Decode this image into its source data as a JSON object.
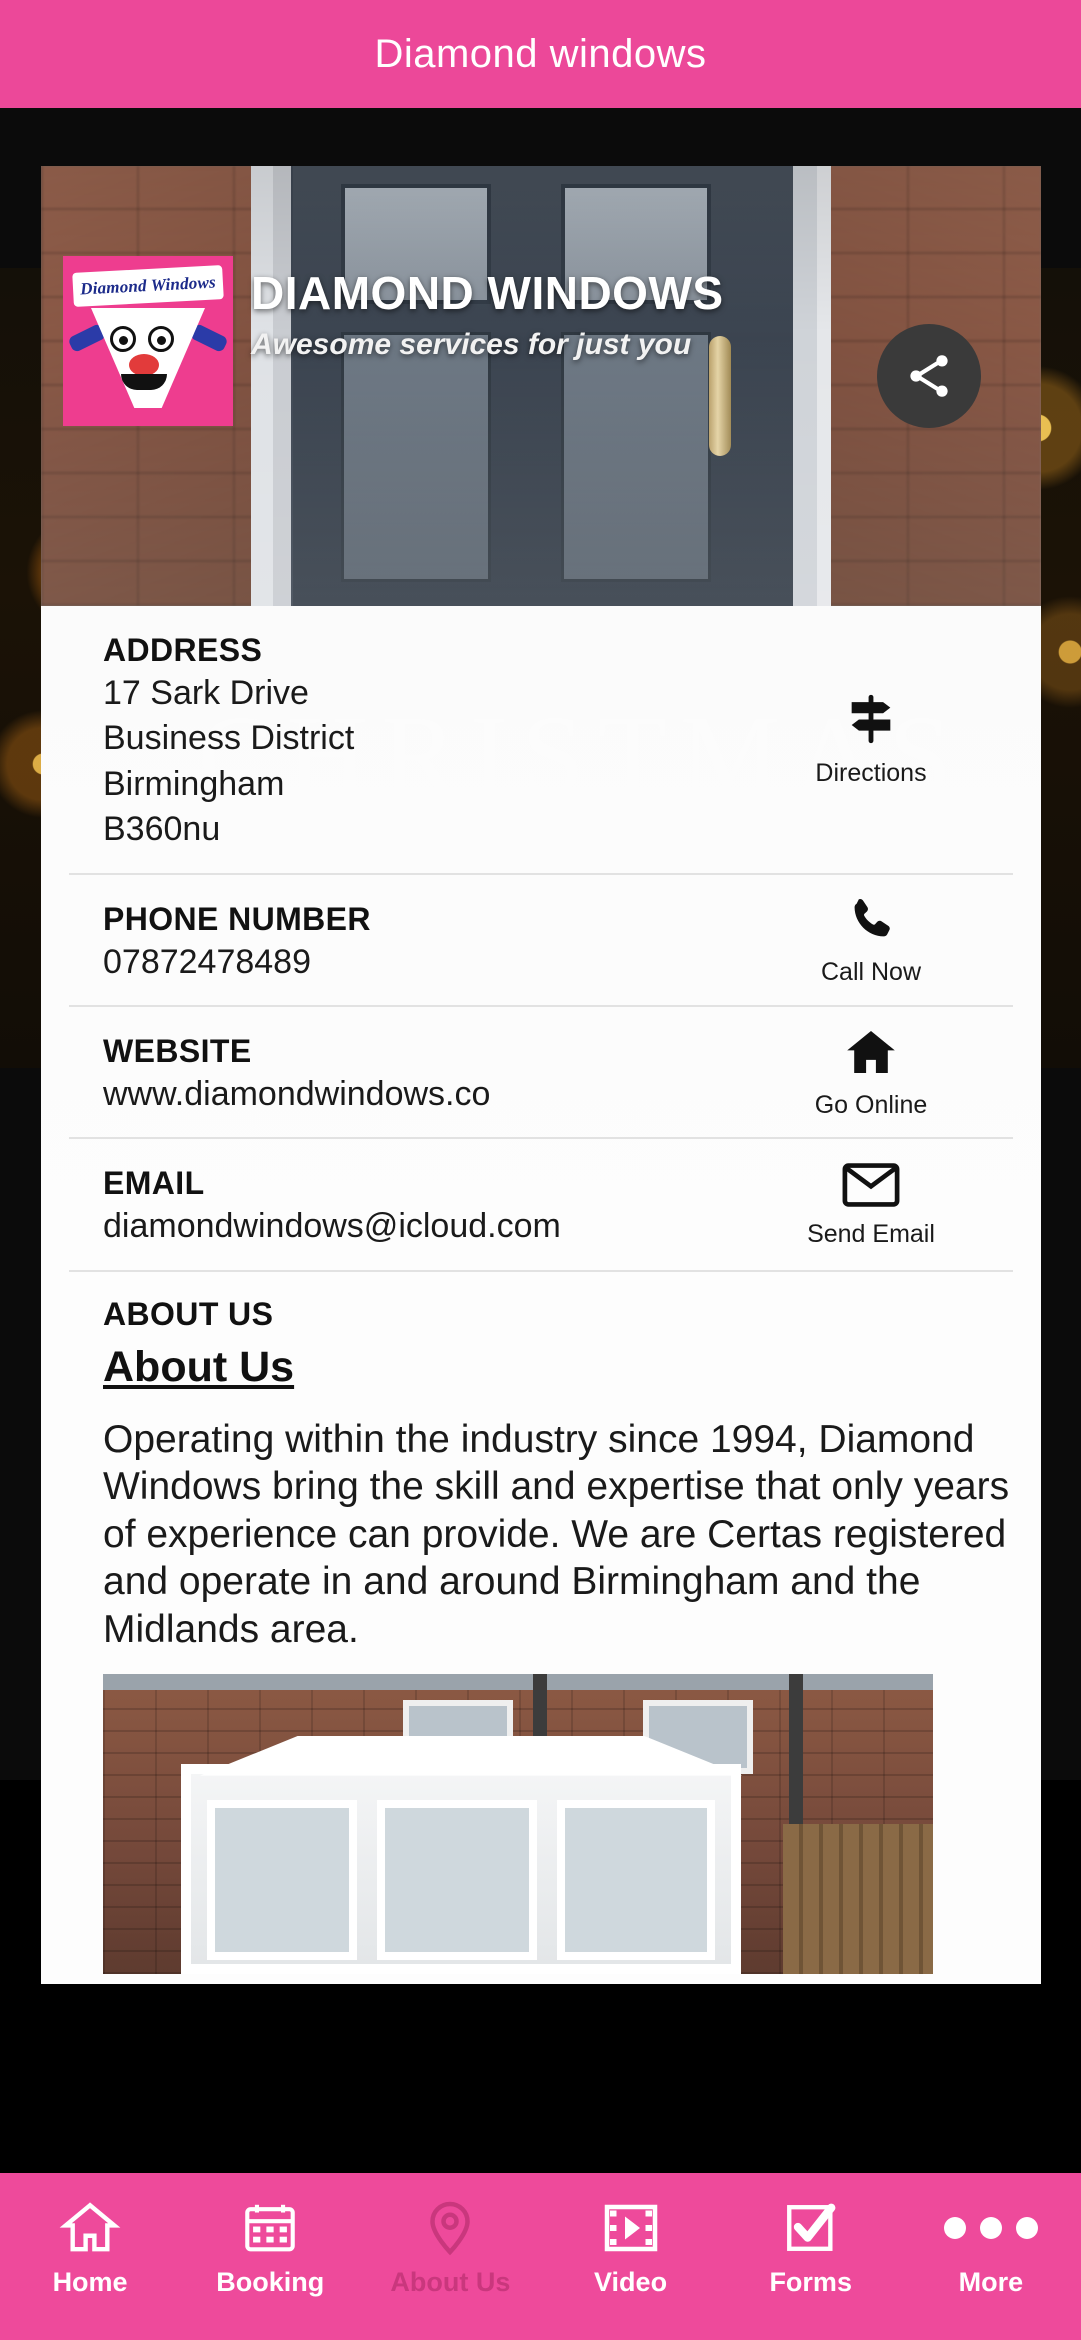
{
  "topbar": {
    "title": "Diamond windows"
  },
  "hero": {
    "business_name": "DIAMOND WINDOWS",
    "tagline": "Awesome services for just you",
    "logo_text": "Diamond Windows",
    "share_icon": "share-icon",
    "watermark": "CHRISTMAS"
  },
  "info": {
    "address": {
      "label": "ADDRESS",
      "lines": [
        "17 Sark Drive",
        "Business District",
        "Birmingham",
        "B360nu"
      ],
      "action_label": "Directions",
      "action_icon": "signpost-icon"
    },
    "phone": {
      "label": "PHONE NUMBER",
      "value": "07872478489",
      "action_label": "Call Now",
      "action_icon": "phone-icon"
    },
    "website": {
      "label": "WEBSITE",
      "value": "www.diamondwindows.co",
      "action_label": "Go Online",
      "action_icon": "home-icon"
    },
    "email": {
      "label": "EMAIL",
      "value": "diamondwindows@icloud.com",
      "action_label": "Send Email",
      "action_icon": "envelope-icon"
    }
  },
  "about": {
    "kicker": "ABOUT US",
    "heading": "About Us",
    "body": "Operating within the industry since 1994, Diamond Windows bring the skill and expertise that only years of experience can provide. We are Certas registered and operate in and around Birmingham and the Midlands area."
  },
  "bottom_nav": {
    "items": [
      {
        "label": "Home",
        "icon": "home-icon",
        "active": false
      },
      {
        "label": "Booking",
        "icon": "calendar-icon",
        "active": false
      },
      {
        "label": "About Us",
        "icon": "map-pin-icon",
        "active": true
      },
      {
        "label": "Video",
        "icon": "film-icon",
        "active": false
      },
      {
        "label": "Forms",
        "icon": "checklist-icon",
        "active": false
      },
      {
        "label": "More",
        "icon": "ellipsis-icon",
        "active": false
      }
    ]
  },
  "colors": {
    "brand_pink": "#ec4899",
    "nav_pink": "#ee4a9b",
    "active_nav": "#c9377d",
    "card_bg": "#fdfdfd"
  }
}
